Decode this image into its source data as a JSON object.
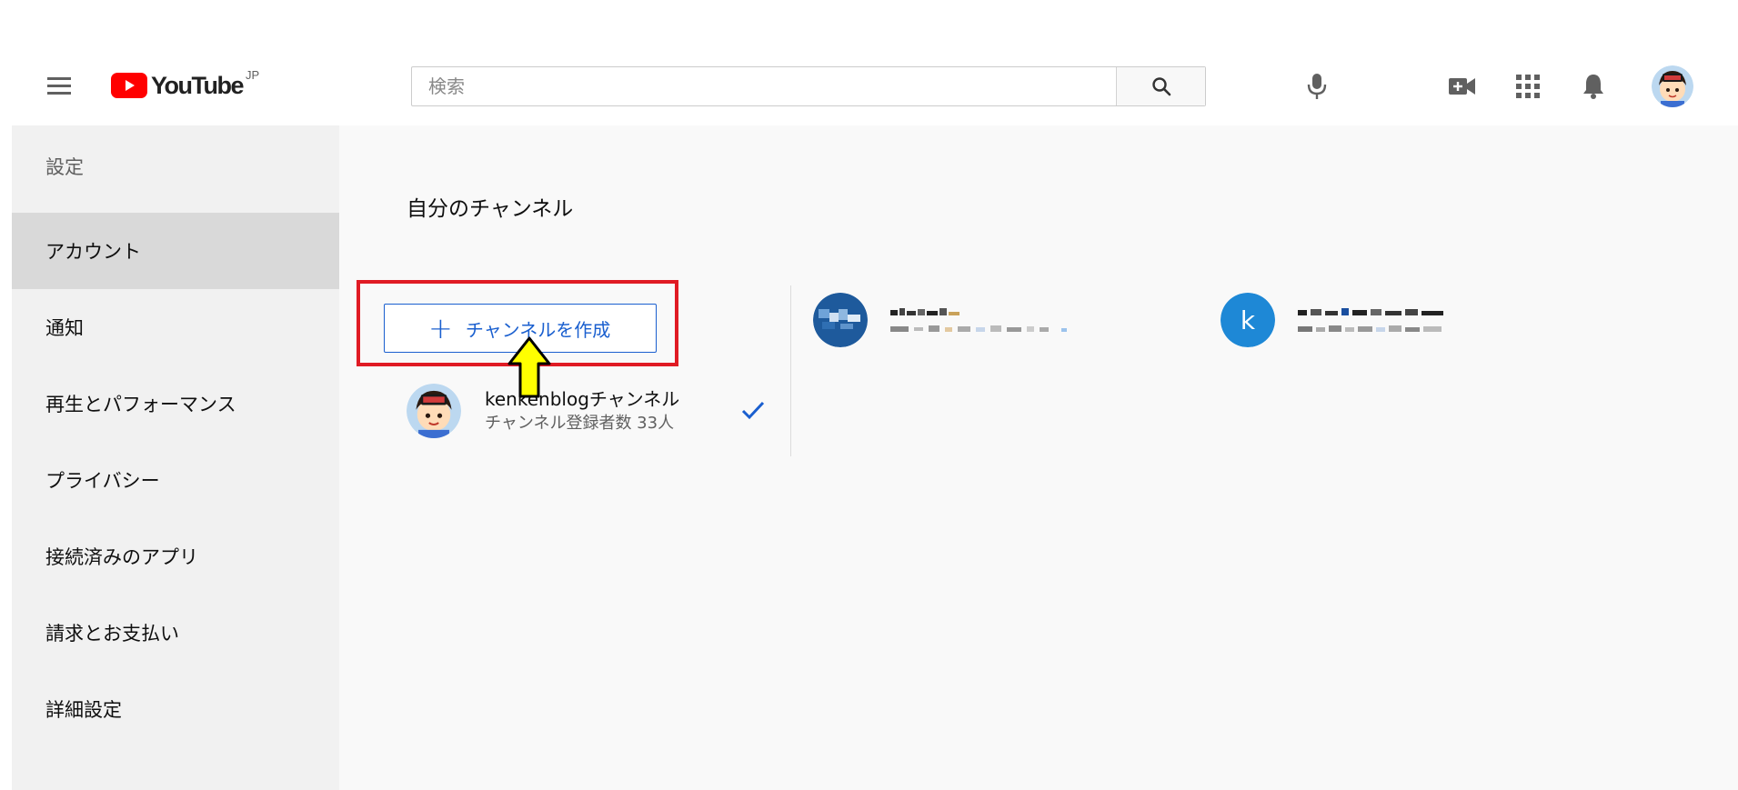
{
  "header": {
    "logo_text": "YouTube",
    "logo_country": "JP",
    "search_placeholder": "検索"
  },
  "sidebar": {
    "heading": "設定",
    "items": [
      {
        "label": "アカウント",
        "active": true
      },
      {
        "label": "通知"
      },
      {
        "label": "再生とパフォーマンス"
      },
      {
        "label": "プライバシー"
      },
      {
        "label": "接続済みのアプリ"
      },
      {
        "label": "請求とお支払い"
      },
      {
        "label": "詳細設定"
      }
    ]
  },
  "main": {
    "section_title": "自分のチャンネル",
    "create_channel_label": "チャンネルを作成",
    "current_channel": {
      "name": "kenkenblogチャンネル",
      "subscribers": "チャンネル登録者数 33人"
    },
    "other_channel_2_avatar_letter": "k"
  },
  "colors": {
    "accent_blue": "#1a5fcf",
    "highlight_red": "#e01b24",
    "arrow_yellow": "#ffff00",
    "youtube_red": "#ff0000"
  },
  "icons": [
    "menu-icon",
    "youtube-logo-icon",
    "search-icon",
    "microphone-icon",
    "video-camera-icon",
    "apps-grid-icon",
    "bell-icon",
    "plus-icon",
    "check-icon",
    "arrow-up-annotation-icon"
  ]
}
